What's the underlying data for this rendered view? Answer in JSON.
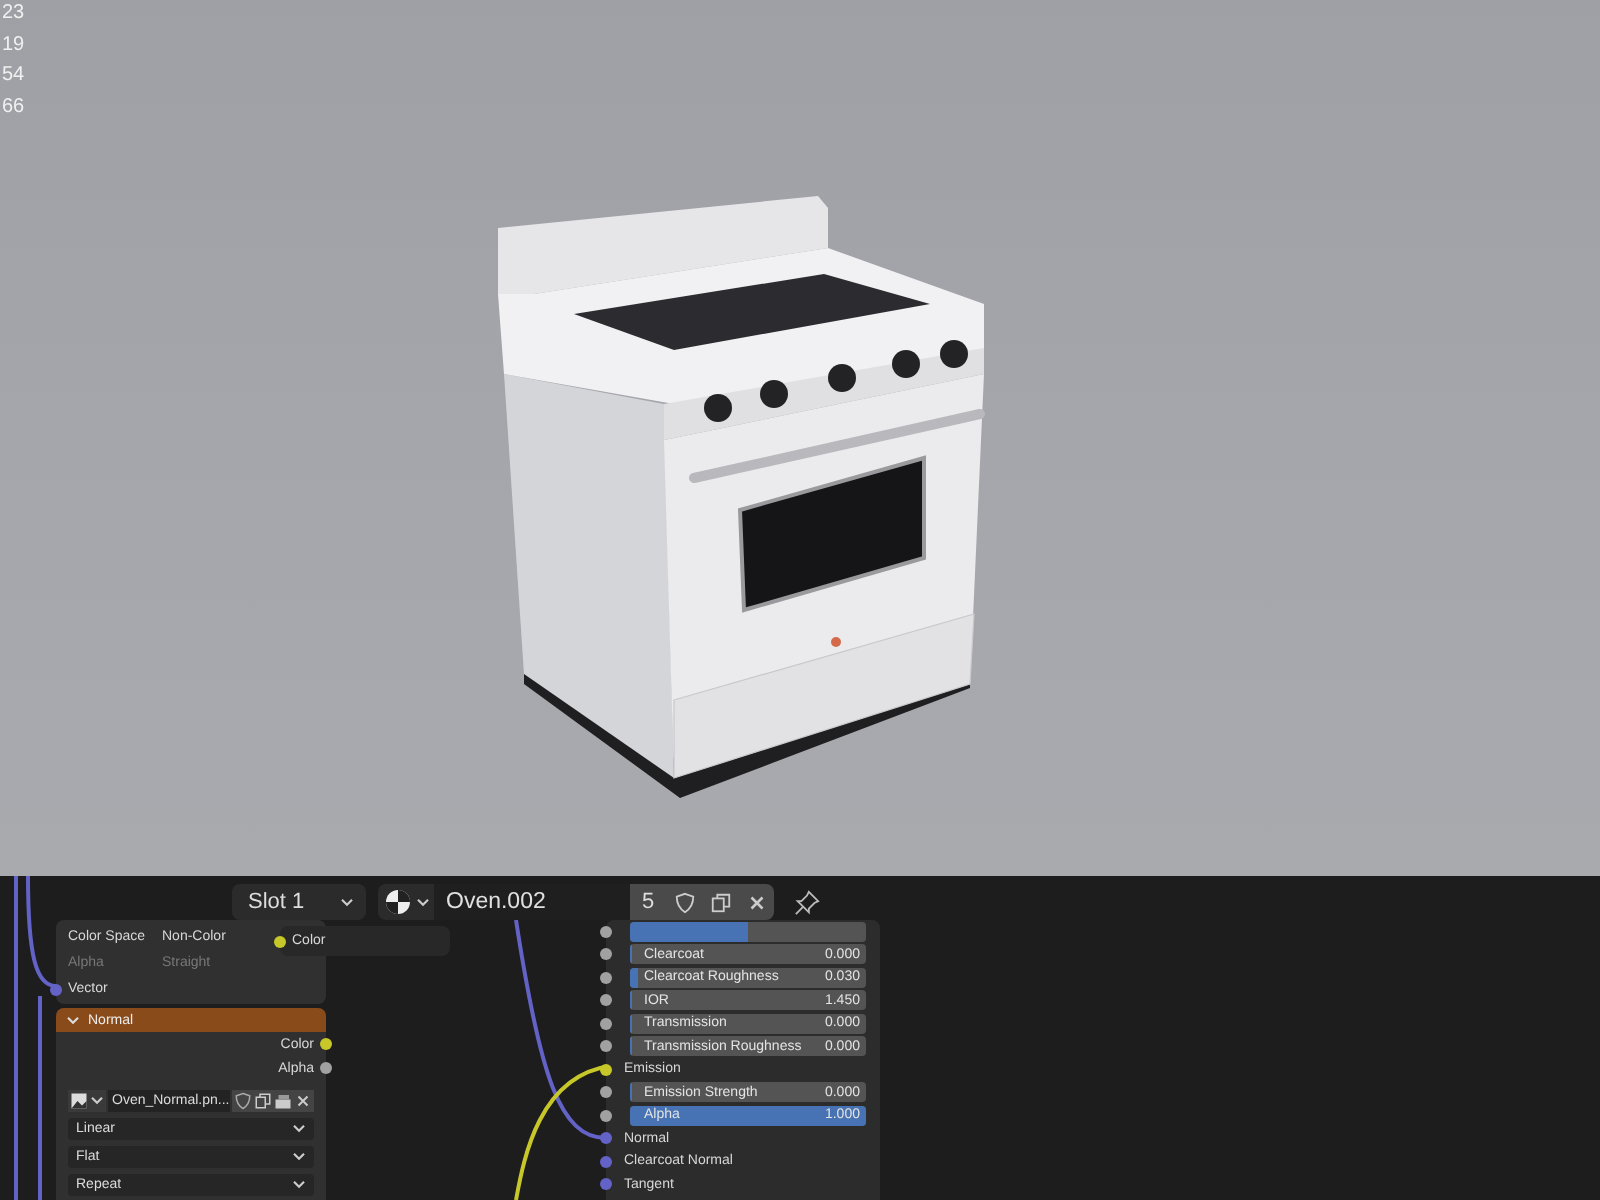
{
  "viewport": {
    "stats": [
      "23",
      "19",
      "54",
      "66"
    ]
  },
  "header": {
    "slot": "Slot 1",
    "material_name": "Oven.002",
    "users": "5"
  },
  "image_node": {
    "rows": [
      {
        "label": "Color Space",
        "value": "Non-Color",
        "disabled": false
      },
      {
        "label": "Alpha",
        "value": "Straight",
        "disabled": true
      }
    ],
    "inputs": [
      {
        "label": "Vector",
        "color": "#6363c7"
      }
    ]
  },
  "popup_node": {
    "outputs": [
      {
        "label": "Color",
        "color": "#c7c729"
      }
    ]
  },
  "normal_node": {
    "title": "Normal",
    "outputs": [
      {
        "label": "Color",
        "color": "#c7c729"
      },
      {
        "label": "Alpha",
        "color": "#a1a1a1"
      }
    ],
    "image": "Oven_Normal.pn...",
    "dropdowns": [
      "Linear",
      "Flat",
      "Repeat"
    ]
  },
  "bsdf_node": {
    "inputs": [
      {
        "kind": "slider",
        "level": 0.5,
        "color": "#a1a1a1"
      },
      {
        "kind": "slider",
        "label": "Clearcoat",
        "value": "0.000",
        "level": 0,
        "color": "#a1a1a1"
      },
      {
        "kind": "slider",
        "label": "Clearcoat Roughness",
        "value": "0.030",
        "level": 0.03,
        "color": "#a1a1a1"
      },
      {
        "kind": "slider",
        "label": "IOR",
        "value": "1.450",
        "level": 0,
        "color": "#a1a1a1"
      },
      {
        "kind": "slider",
        "label": "Transmission",
        "value": "0.000",
        "level": 0,
        "color": "#a1a1a1"
      },
      {
        "kind": "slider",
        "label": "Transmission Roughness",
        "value": "0.000",
        "level": 0,
        "color": "#a1a1a1"
      },
      {
        "kind": "socket",
        "label": "Emission",
        "color": "#c7c729"
      },
      {
        "kind": "slider",
        "label": "Emission Strength",
        "value": "0.000",
        "level": 0,
        "color": "#a1a1a1"
      },
      {
        "kind": "slider",
        "label": "Alpha",
        "value": "1.000",
        "level": 1,
        "color": "#a1a1a1"
      },
      {
        "kind": "socket",
        "label": "Normal",
        "color": "#6363c7"
      },
      {
        "kind": "socket",
        "label": "Clearcoat Normal",
        "color": "#6363c7"
      },
      {
        "kind": "socket",
        "label": "Tangent",
        "color": "#6363c7"
      }
    ]
  }
}
